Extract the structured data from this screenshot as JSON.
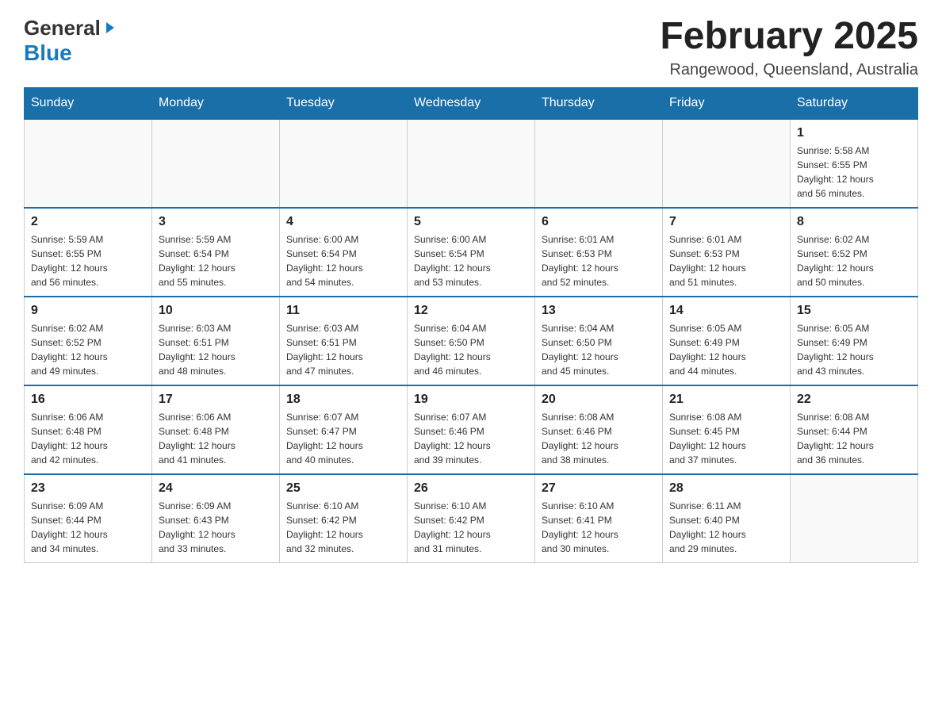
{
  "header": {
    "logo_general": "General",
    "logo_blue": "Blue",
    "title": "February 2025",
    "location": "Rangewood, Queensland, Australia"
  },
  "weekdays": [
    "Sunday",
    "Monday",
    "Tuesday",
    "Wednesday",
    "Thursday",
    "Friday",
    "Saturday"
  ],
  "weeks": [
    [
      {
        "day": "",
        "info": ""
      },
      {
        "day": "",
        "info": ""
      },
      {
        "day": "",
        "info": ""
      },
      {
        "day": "",
        "info": ""
      },
      {
        "day": "",
        "info": ""
      },
      {
        "day": "",
        "info": ""
      },
      {
        "day": "1",
        "info": "Sunrise: 5:58 AM\nSunset: 6:55 PM\nDaylight: 12 hours\nand 56 minutes."
      }
    ],
    [
      {
        "day": "2",
        "info": "Sunrise: 5:59 AM\nSunset: 6:55 PM\nDaylight: 12 hours\nand 56 minutes."
      },
      {
        "day": "3",
        "info": "Sunrise: 5:59 AM\nSunset: 6:54 PM\nDaylight: 12 hours\nand 55 minutes."
      },
      {
        "day": "4",
        "info": "Sunrise: 6:00 AM\nSunset: 6:54 PM\nDaylight: 12 hours\nand 54 minutes."
      },
      {
        "day": "5",
        "info": "Sunrise: 6:00 AM\nSunset: 6:54 PM\nDaylight: 12 hours\nand 53 minutes."
      },
      {
        "day": "6",
        "info": "Sunrise: 6:01 AM\nSunset: 6:53 PM\nDaylight: 12 hours\nand 52 minutes."
      },
      {
        "day": "7",
        "info": "Sunrise: 6:01 AM\nSunset: 6:53 PM\nDaylight: 12 hours\nand 51 minutes."
      },
      {
        "day": "8",
        "info": "Sunrise: 6:02 AM\nSunset: 6:52 PM\nDaylight: 12 hours\nand 50 minutes."
      }
    ],
    [
      {
        "day": "9",
        "info": "Sunrise: 6:02 AM\nSunset: 6:52 PM\nDaylight: 12 hours\nand 49 minutes."
      },
      {
        "day": "10",
        "info": "Sunrise: 6:03 AM\nSunset: 6:51 PM\nDaylight: 12 hours\nand 48 minutes."
      },
      {
        "day": "11",
        "info": "Sunrise: 6:03 AM\nSunset: 6:51 PM\nDaylight: 12 hours\nand 47 minutes."
      },
      {
        "day": "12",
        "info": "Sunrise: 6:04 AM\nSunset: 6:50 PM\nDaylight: 12 hours\nand 46 minutes."
      },
      {
        "day": "13",
        "info": "Sunrise: 6:04 AM\nSunset: 6:50 PM\nDaylight: 12 hours\nand 45 minutes."
      },
      {
        "day": "14",
        "info": "Sunrise: 6:05 AM\nSunset: 6:49 PM\nDaylight: 12 hours\nand 44 minutes."
      },
      {
        "day": "15",
        "info": "Sunrise: 6:05 AM\nSunset: 6:49 PM\nDaylight: 12 hours\nand 43 minutes."
      }
    ],
    [
      {
        "day": "16",
        "info": "Sunrise: 6:06 AM\nSunset: 6:48 PM\nDaylight: 12 hours\nand 42 minutes."
      },
      {
        "day": "17",
        "info": "Sunrise: 6:06 AM\nSunset: 6:48 PM\nDaylight: 12 hours\nand 41 minutes."
      },
      {
        "day": "18",
        "info": "Sunrise: 6:07 AM\nSunset: 6:47 PM\nDaylight: 12 hours\nand 40 minutes."
      },
      {
        "day": "19",
        "info": "Sunrise: 6:07 AM\nSunset: 6:46 PM\nDaylight: 12 hours\nand 39 minutes."
      },
      {
        "day": "20",
        "info": "Sunrise: 6:08 AM\nSunset: 6:46 PM\nDaylight: 12 hours\nand 38 minutes."
      },
      {
        "day": "21",
        "info": "Sunrise: 6:08 AM\nSunset: 6:45 PM\nDaylight: 12 hours\nand 37 minutes."
      },
      {
        "day": "22",
        "info": "Sunrise: 6:08 AM\nSunset: 6:44 PM\nDaylight: 12 hours\nand 36 minutes."
      }
    ],
    [
      {
        "day": "23",
        "info": "Sunrise: 6:09 AM\nSunset: 6:44 PM\nDaylight: 12 hours\nand 34 minutes."
      },
      {
        "day": "24",
        "info": "Sunrise: 6:09 AM\nSunset: 6:43 PM\nDaylight: 12 hours\nand 33 minutes."
      },
      {
        "day": "25",
        "info": "Sunrise: 6:10 AM\nSunset: 6:42 PM\nDaylight: 12 hours\nand 32 minutes."
      },
      {
        "day": "26",
        "info": "Sunrise: 6:10 AM\nSunset: 6:42 PM\nDaylight: 12 hours\nand 31 minutes."
      },
      {
        "day": "27",
        "info": "Sunrise: 6:10 AM\nSunset: 6:41 PM\nDaylight: 12 hours\nand 30 minutes."
      },
      {
        "day": "28",
        "info": "Sunrise: 6:11 AM\nSunset: 6:40 PM\nDaylight: 12 hours\nand 29 minutes."
      },
      {
        "day": "",
        "info": ""
      }
    ]
  ]
}
